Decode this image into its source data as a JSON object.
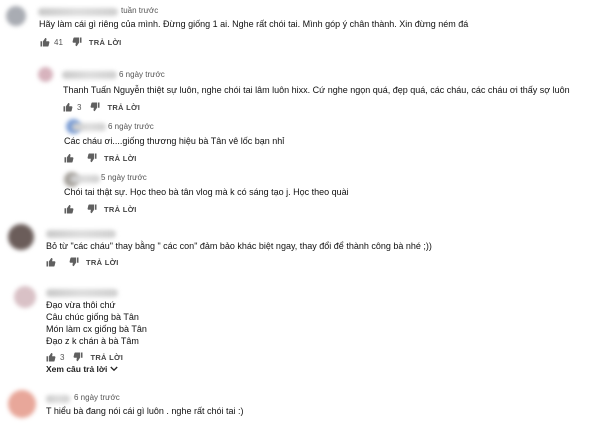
{
  "colors": {
    "avatar_grey": "#a9acb3",
    "avatar_pink": "#d7b3bd",
    "avatar_blue": "#7d9fd6",
    "avatar_dark": "#6b5d5a",
    "avatar_salmon": "#e8a79a"
  },
  "comments": [
    {
      "time": "tuần trước",
      "text": "Hãy làm cái gì riêng của mình. Đừng giống 1 ai. Nghe rất chói tai. Mình góp ý chân thành. Xin đừng ném đá",
      "likes": "41",
      "reply_label": "TRẢ LỜI"
    },
    {
      "time": "6 ngày trước",
      "text": "Thanh Tuấn Nguyễn thiệt sự luôn, nghe chói tai lâm luôn hixx. Cứ nghe ngọn quá, đẹp quá, các cháu, các cháu ơi thấy sợ luôn",
      "likes": "3",
      "reply_label": "TRẢ LỜI"
    },
    {
      "time": "6 ngày trước",
      "text": "Các cháu ơi....giống thương hiệu bà Tân vê lốc bạn nhỉ",
      "likes": "",
      "reply_label": "TRẢ LỜI"
    },
    {
      "time": "5 ngày trước",
      "text": "Chói tai thật sự. Học theo bà tân vlog mà k có sáng tạo j. Học theo quài",
      "likes": "",
      "reply_label": "TRẢ LỜI"
    },
    {
      "time": "",
      "text": "Bỏ từ \"các cháu\" thay bằng \" các con\" đảm bảo khác biệt ngay, thay đổi để thành công bà nhé ;))",
      "likes": "",
      "reply_label": "TRẢ LỜI"
    },
    {
      "time": "",
      "lines": [
        "Đạo vừa thôi chứ",
        "Câu chúc giống bà Tân",
        "Món làm cx giống bà Tân",
        "Đạo z k chán à bà Tâm"
      ],
      "likes": "3",
      "reply_label": "TRẢ LỜI"
    },
    {
      "time": "6 ngày trước",
      "text": "T hiểu bà đang nói cái gì luôn . nghe rất chói tai :)"
    }
  ],
  "view_replies_label": "Xem câu trả lời",
  "icons": {
    "like": "thumbs-up-icon",
    "dislike": "thumbs-down-icon",
    "expand": "chevron-down-icon"
  }
}
